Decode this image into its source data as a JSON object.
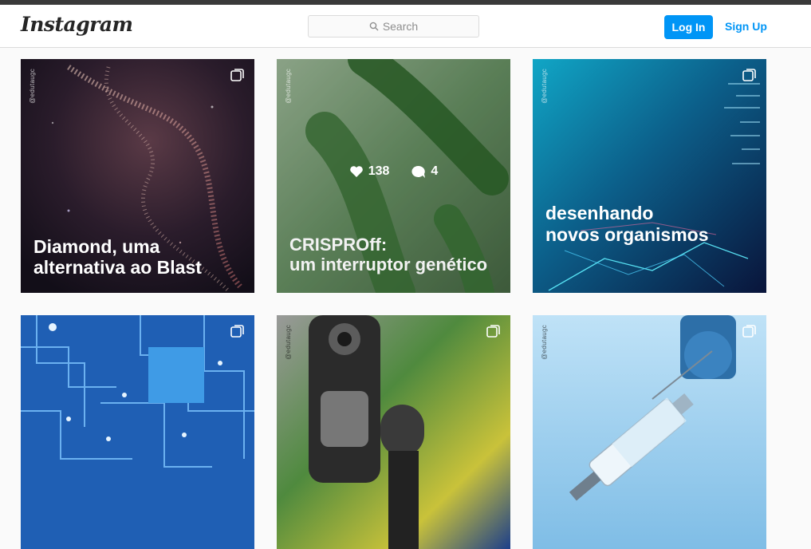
{
  "header": {
    "logo": "Instagram",
    "search_placeholder": "Search",
    "login_label": "Log In",
    "signup_label": "Sign Up"
  },
  "posts": [
    {
      "handle": "@edutaugc",
      "caption_lines": [
        "Diamond, uma",
        "alternativa ao Blast"
      ],
      "multiple": true
    },
    {
      "handle": "@edutaugc",
      "caption_lines": [
        "CRISPROff:",
        "um interruptor genético"
      ],
      "likes": "138",
      "comments": "4",
      "multiple": false
    },
    {
      "handle": "@edutaugc",
      "caption_lines": [
        "desenhando",
        "novos organismos"
      ],
      "multiple": true
    },
    {
      "handle": "",
      "caption_lines": [],
      "multiple": true
    },
    {
      "handle": "@edutaugc",
      "caption_lines": [],
      "multiple": true
    },
    {
      "handle": "@edutaugc",
      "caption_lines": [],
      "multiple": true
    }
  ],
  "icons": {
    "search": "search-icon",
    "multiple": "multiple-posts-icon",
    "like": "heart-icon",
    "comment": "comment-icon"
  },
  "colors": {
    "accent": "#0095f6",
    "border": "#dbdbdb",
    "background": "#fafafa"
  }
}
